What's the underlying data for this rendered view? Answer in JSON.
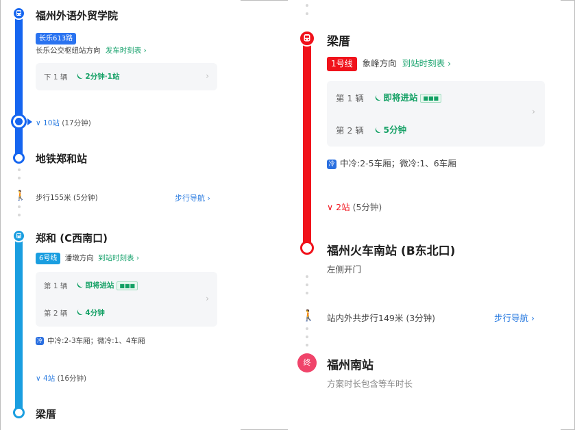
{
  "left": {
    "start_station": "福州外语外贸学院",
    "bus_line": "长乐613路",
    "bus_direction": "长乐公交枢纽站方向",
    "bus_timetable_link": "发车时刻表 ›",
    "bus_next_label": "下 1 辆",
    "bus_next_eta": "2分钟·1站",
    "bus_stops_summary": "10站",
    "bus_stops_duration": "(17分钟)",
    "bus_alight_station": "地铁郑和站",
    "walk_text": "步行155米 (5分钟)",
    "walk_nav_link": "步行导航 ›",
    "metro_board_station": "郑和 (C西南口)",
    "metro_line": "6号线",
    "metro_direction": "潘墩方向",
    "metro_timetable_link": "到站时刻表 ›",
    "metro_car1_label": "第 1 辆",
    "metro_car1_eta": "即将进站",
    "metro_car2_label": "第 2 辆",
    "metro_car2_eta": "4分钟",
    "metro_car_tag": "■■■",
    "metro_aircon_icon_text": "冷",
    "metro_aircon_info": "中冷:2-3车厢；微冷:1、4车厢",
    "metro_stops_summary": "4站",
    "metro_stops_duration": "(16分钟)",
    "metro_transfer_station": "梁厝"
  },
  "right": {
    "transfer_station": "梁厝",
    "metro_line": "1号线",
    "metro_direction": "象峰方向",
    "metro_timetable_link": "到站时刻表 ›",
    "car1_label": "第 1 辆",
    "car1_eta": "即将进站",
    "car2_label": "第 2 辆",
    "car2_eta": "5分钟",
    "car_tag": "■■■",
    "aircon_icon_text": "冷",
    "aircon_info": "中冷:2-5车厢；微冷:1、6车厢",
    "stops_summary": "2站",
    "stops_duration": "(5分钟)",
    "alight_station": "福州火车南站 (B东北口)",
    "door_side": "左侧开门",
    "walk_text": "站内外共步行149米 (3分钟)",
    "walk_nav_link": "步行导航 ›",
    "end_marker": "终",
    "end_station": "福州南站",
    "end_note": "方案时长包含等车时长"
  },
  "colors": {
    "bus_line": "#1565f0",
    "metro6": "#1a9ee0",
    "metro1": "#f0121b",
    "green": "#13a064",
    "link_blue": "#2a7be0",
    "end_marker": "#f0446a"
  },
  "icons": {
    "bus": "bus-icon",
    "metro": "metro-icon",
    "walk": "walk-icon",
    "realtime": "realtime-signal-icon",
    "aircon": "aircon-icon",
    "chevron": "chevron-right-icon",
    "expand": "chevron-down-icon"
  }
}
